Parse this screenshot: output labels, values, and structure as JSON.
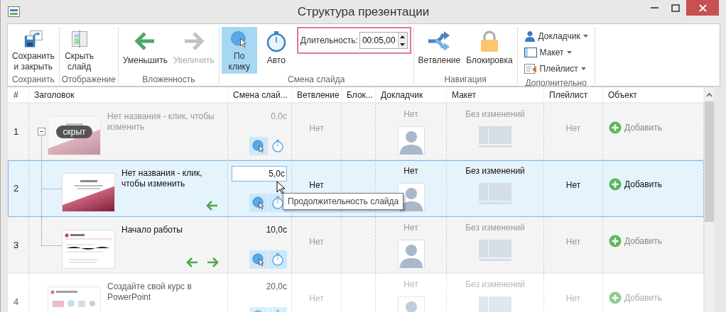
{
  "window": {
    "title": "Структура презентации"
  },
  "ribbon": {
    "groups": [
      {
        "label": "Сохранить",
        "items": [
          {
            "kind": "save",
            "label": "Сохранить\nи закрыть",
            "disabled": false
          }
        ]
      },
      {
        "label": "Отображение",
        "items": [
          {
            "kind": "hide",
            "label": "Скрыть\nслайд",
            "disabled": false
          }
        ]
      },
      {
        "label": "Вложенность",
        "items": [
          {
            "kind": "outdent",
            "label": "Уменьшить",
            "disabled": false
          },
          {
            "kind": "indent",
            "label": "Увеличить",
            "disabled": true
          }
        ]
      },
      {
        "label": "Смена слайда",
        "items": [
          {
            "kind": "click",
            "label": "По\nклику",
            "selected": true
          },
          {
            "kind": "auto",
            "label": "Авто",
            "selected": false
          },
          {
            "kind": "duration",
            "label": "Длительность:",
            "value": "00:05,00",
            "highlighted": true
          }
        ]
      },
      {
        "label": "Навигация",
        "items": [
          {
            "kind": "branch",
            "label": "Ветвление",
            "disabled": false
          },
          {
            "kind": "lock",
            "label": "Блокировка",
            "disabled": false
          }
        ]
      },
      {
        "label": "Дополнительно",
        "items": [
          {
            "kind": "speaker",
            "label": "Докладчик"
          },
          {
            "kind": "layout",
            "label": "Макет"
          },
          {
            "kind": "playlist",
            "label": "Плейлист"
          }
        ]
      }
    ]
  },
  "table": {
    "columns": [
      "#",
      "Заголовок",
      "Смена слай...",
      "Ветвление",
      "Блок...",
      "Докладчик",
      "Макет",
      "Плейлист",
      "Объект"
    ],
    "tooltip": "Продолжительность слайда",
    "rows": [
      {
        "number": "1",
        "title": "Нет названия - клик, чтобы изменить",
        "kind": "title",
        "hidden": true,
        "hidden_badge": "скрыт",
        "selected": false,
        "expanded": true,
        "duration": "0,0с",
        "editing": false,
        "click": true,
        "auto": false,
        "outdent": false,
        "indent": false,
        "branch": "Нет",
        "presenter": "Нет",
        "layout": "Без изменений",
        "playlist": "Нет",
        "object": "Добавить",
        "children": [
          {
            "number": "2",
            "title": "Нет названия - клик, чтобы изменить",
            "kind": "title",
            "hidden": false,
            "selected": true,
            "duration": "5,0с",
            "editing": true,
            "click": true,
            "auto": true,
            "outdent": true,
            "indent": false,
            "branch": "Нет",
            "presenter": "Нет",
            "layout": "Без изменений",
            "playlist": "Нет",
            "object": "Добавить"
          },
          {
            "number": "3",
            "title": "Начало работы",
            "kind": "text",
            "hidden": false,
            "selected": false,
            "duration": "10,0с",
            "editing": false,
            "click": true,
            "auto": true,
            "outdent": true,
            "indent": true,
            "branch": "Нет",
            "presenter": "Нет",
            "layout": "Без изменений",
            "playlist": "Нет",
            "object": "Добавить"
          }
        ]
      },
      {
        "number": "4",
        "title": "Создайте свой курс в PowerPoint",
        "kind": "grid",
        "hidden": false,
        "selected": false,
        "duration": "20,0с",
        "editing": false,
        "click": true,
        "auto": true,
        "outdent": false,
        "indent": false,
        "branch": "Нет",
        "presenter": "Нет",
        "layout": "Без изменений",
        "playlist": "Нет",
        "object": "Добавить"
      }
    ]
  }
}
